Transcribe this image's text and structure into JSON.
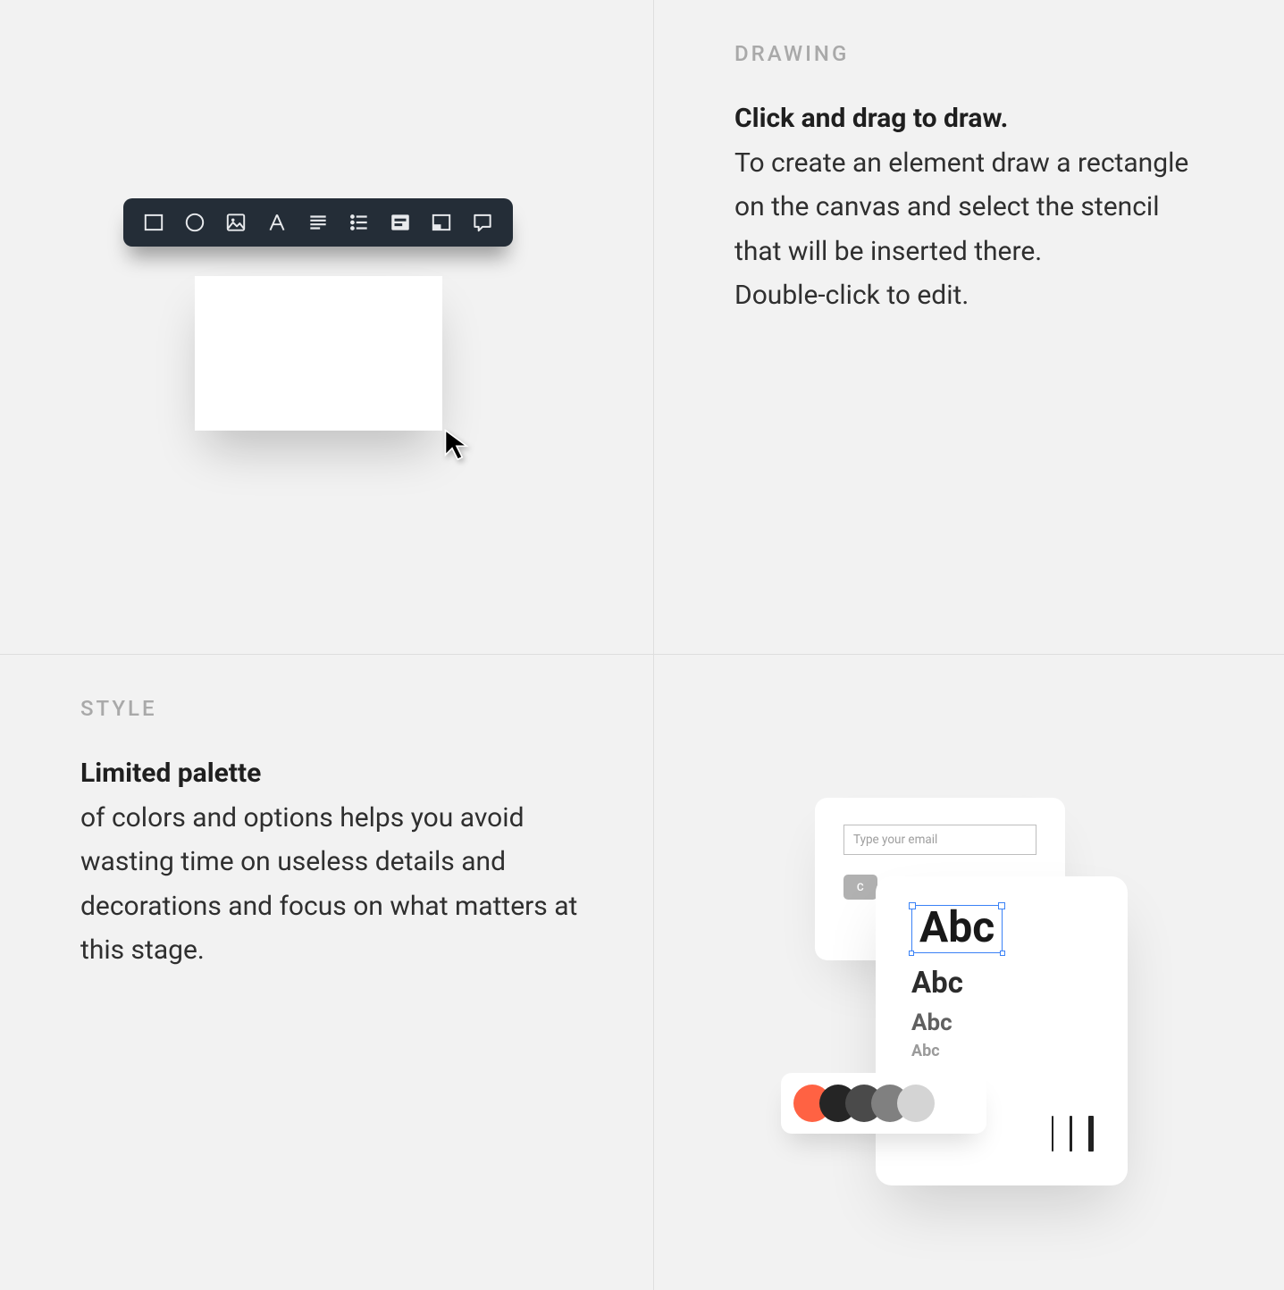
{
  "sections": {
    "drawing": {
      "kicker": "DRAWING",
      "title": "Click and drag to draw.",
      "body_line1": "To create an element draw a rectangle on the canvas and select the stencil that will be inserted there.",
      "body_line2": "Double-click to edit."
    },
    "style": {
      "kicker": "STYLE",
      "title": "Limited palette",
      "body": "of colors and options helps you avoid wasting time on useless details and decorations and focus on what matters at this stage."
    }
  },
  "toolbar_icons": [
    "rectangle-icon",
    "circle-icon",
    "image-icon",
    "text-icon",
    "paragraph-icon",
    "list-icon",
    "form-icon",
    "panel-icon",
    "comment-icon"
  ],
  "style_sample": {
    "email_placeholder": "Type your email",
    "button_fragment": "C",
    "abc": {
      "a": "Abc",
      "b": "Abc",
      "c": "Abc",
      "d": "Abc"
    },
    "swatches": [
      "#ff6243",
      "#252525",
      "#4a4a4a",
      "#808080",
      "#d4d4d4"
    ]
  }
}
